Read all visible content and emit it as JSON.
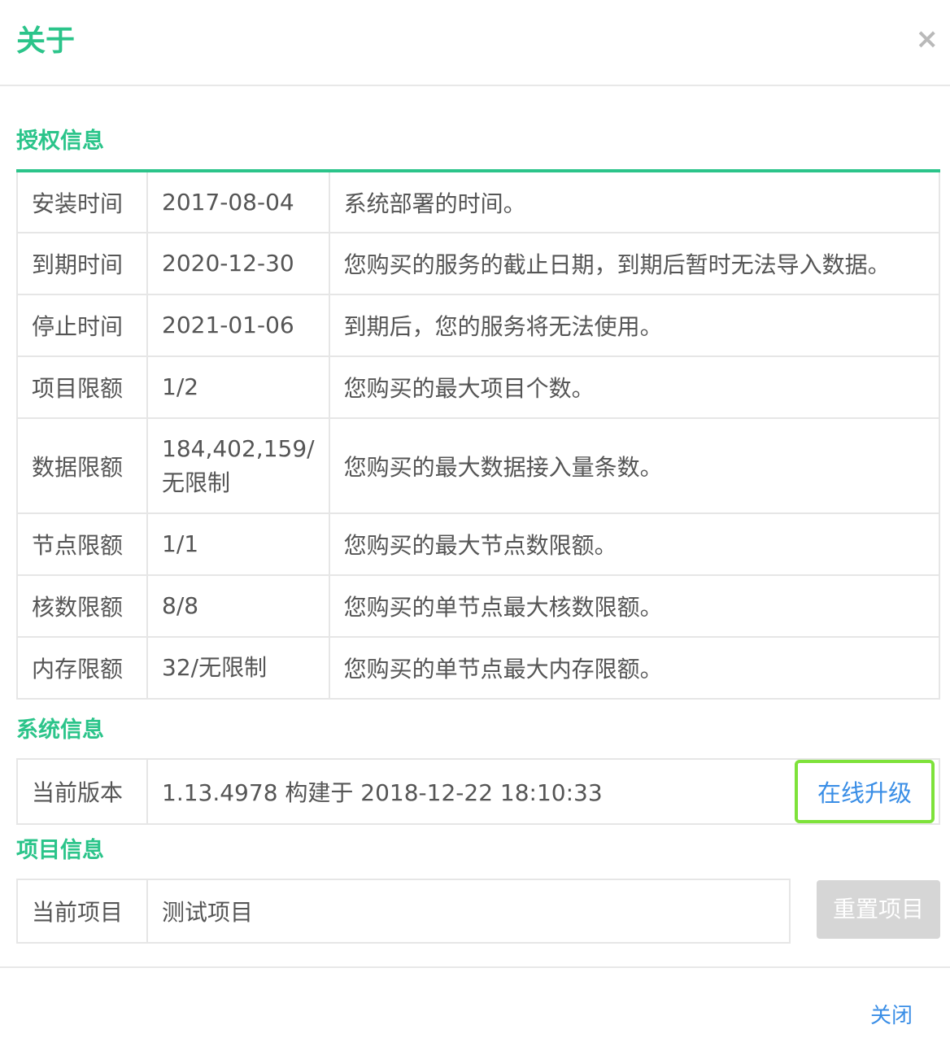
{
  "dialog": {
    "title": "关于",
    "close_icon": "×",
    "footer_close": "关闭"
  },
  "auth": {
    "title": "授权信息",
    "rows": [
      {
        "label": "安装时间",
        "value": "2017-08-04",
        "desc": "系统部署的时间。"
      },
      {
        "label": "到期时间",
        "value": "2020-12-30",
        "desc": "您购买的服务的截止日期，到期后暂时无法导入数据。"
      },
      {
        "label": "停止时间",
        "value": "2021-01-06",
        "desc": "到期后，您的服务将无法使用。"
      },
      {
        "label": "项目限额",
        "value": "1/2",
        "desc": "您购买的最大项目个数。"
      },
      {
        "label": "数据限额",
        "value": "184,402,159/无限制",
        "desc": "您购买的最大数据接入量条数。"
      },
      {
        "label": "节点限额",
        "value": "1/1",
        "desc": "您购买的最大节点数限额。"
      },
      {
        "label": "核数限额",
        "value": "8/8",
        "desc": "您购买的单节点最大核数限额。"
      },
      {
        "label": "内存限额",
        "value": "32/无限制",
        "desc": "您购买的单节点最大内存限额。"
      }
    ]
  },
  "system": {
    "title": "系统信息",
    "label": "当前版本",
    "value": "1.13.4978 构建于 2018-12-22 18:10:33",
    "upgrade": "在线升级"
  },
  "project": {
    "title": "项目信息",
    "label": "当前项目",
    "value": "测试项目",
    "reset": "重置项目"
  },
  "colors": {
    "accent": "#2bc48a",
    "link": "#3a8ee6",
    "highlight": "#7ee23a",
    "disabled": "#d6d6d6"
  }
}
